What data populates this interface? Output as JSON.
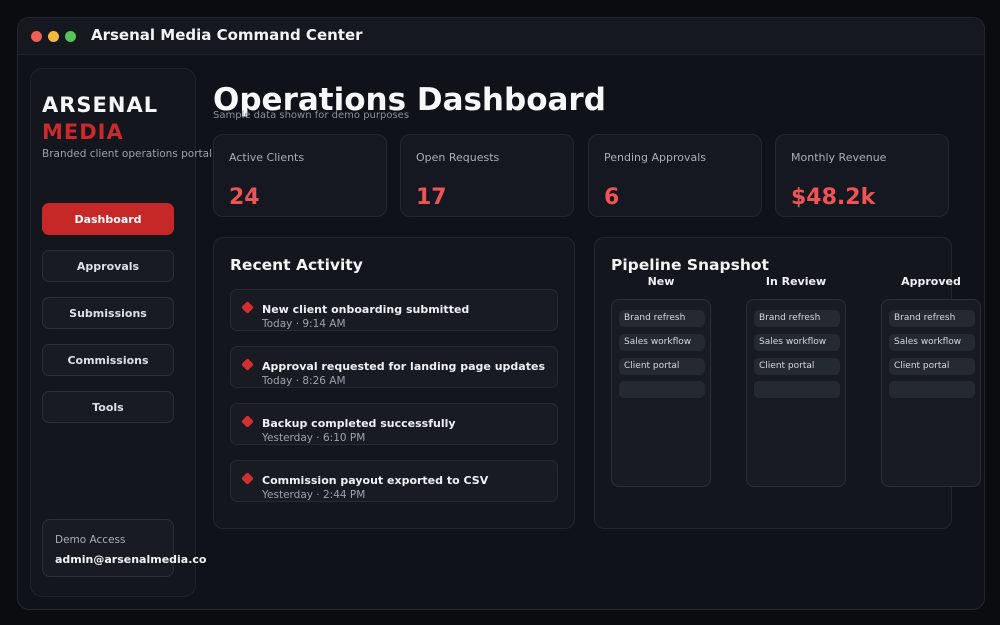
{
  "window": {
    "title": "Arsenal Media Command Center",
    "traffic_lights": [
      "#ed5f57",
      "#f5b93a",
      "#5ac05a"
    ]
  },
  "sidebar": {
    "brand_line1": "ARSENAL",
    "brand_line2": "MEDIA",
    "tagline": "Branded client operations portal",
    "nav": [
      {
        "label": "Dashboard",
        "active": true
      },
      {
        "label": "Approvals",
        "active": false
      },
      {
        "label": "Submissions",
        "active": false
      },
      {
        "label": "Commissions",
        "active": false
      },
      {
        "label": "Tools",
        "active": false
      }
    ],
    "demo": {
      "label": "Demo Access",
      "email": "admin@arsenalmedia.co"
    }
  },
  "main": {
    "title": "Operations Dashboard",
    "subtitle": "Sample data shown for demo purposes",
    "stats": [
      {
        "label": "Active Clients",
        "value": "24"
      },
      {
        "label": "Open Requests",
        "value": "17"
      },
      {
        "label": "Pending Approvals",
        "value": "6"
      },
      {
        "label": "Monthly Revenue",
        "value": "$48.2k"
      }
    ],
    "activity": {
      "title": "Recent Activity",
      "items": [
        {
          "title": "New client onboarding submitted",
          "time": "Today · 9:14 AM"
        },
        {
          "title": "Approval requested for landing page updates",
          "time": "Today · 8:26 AM"
        },
        {
          "title": "Backup completed successfully",
          "time": "Yesterday · 6:10 PM"
        },
        {
          "title": "Commission payout exported to CSV",
          "time": "Yesterday · 2:44 PM"
        }
      ]
    },
    "pipeline": {
      "title": "Pipeline Snapshot",
      "columns": [
        {
          "name": "New",
          "cards": [
            "Brand refresh",
            "Sales workflow",
            "Client portal",
            ""
          ]
        },
        {
          "name": "In Review",
          "cards": [
            "Brand refresh",
            "Sales workflow",
            "Client portal",
            ""
          ]
        },
        {
          "name": "Approved",
          "cards": [
            "Brand refresh",
            "Sales workflow",
            "Client portal",
            ""
          ]
        }
      ]
    }
  },
  "colors": {
    "accent": "#c62828",
    "stat_value": "#ef5454",
    "background": "#0f1218"
  }
}
